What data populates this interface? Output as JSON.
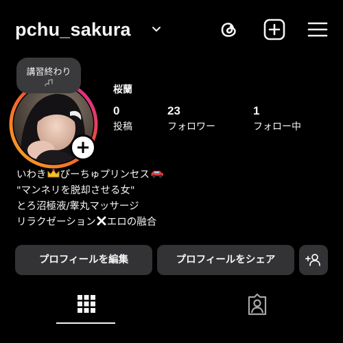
{
  "header": {
    "username": "pchu_sakura",
    "icons": [
      "chevron-down-icon",
      "threads-icon",
      "add-post-icon",
      "hamburger-menu-icon"
    ]
  },
  "note": {
    "text": "講習終わり"
  },
  "profile": {
    "display_name": "桜蘭",
    "stats": {
      "posts": {
        "value": "0",
        "label": "投稿"
      },
      "followers": {
        "value": "23",
        "label": "フォロワー"
      },
      "following": {
        "value": "1",
        "label": "フォロー中"
      }
    },
    "bio": {
      "line1_a": "いわき",
      "line1_b": "ぴーちゅプリンセス",
      "line2": "\"マンネリを脱却させる女\"",
      "line3": "とろ沼極液/睾丸マッサージ",
      "line4_a": "リラクゼーション",
      "line4_b": "エロの融合"
    }
  },
  "buttons": {
    "edit_profile": "プロフィールを編集",
    "share_profile": "プロフィールをシェア",
    "add_person_icon": "add-person-icon"
  },
  "tabs": {
    "grid_icon": "grid-icon",
    "tagged_icon": "tagged-person-icon"
  },
  "colors": {
    "background": "#000000",
    "button_bg": "#333336",
    "ring_start": "#f9a825",
    "ring_end": "#d6249f"
  }
}
